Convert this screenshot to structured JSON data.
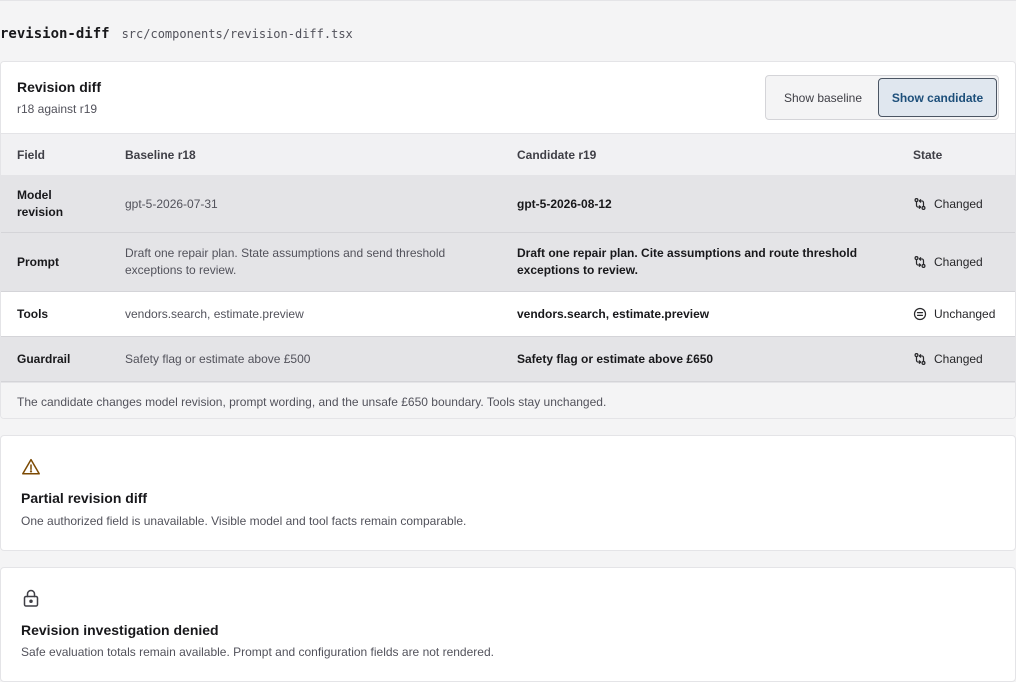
{
  "file": {
    "name": "revision-diff",
    "path": "src/components/revision-diff.tsx"
  },
  "card": {
    "title": "Revision diff",
    "subtitle": "r18 against r19",
    "toggle": {
      "baseline_label": "Show baseline",
      "candidate_label": "Show candidate",
      "selected": "candidate"
    }
  },
  "table": {
    "headers": {
      "field": "Field",
      "baseline": "Baseline r18",
      "candidate": "Candidate r19",
      "state": "State"
    },
    "rows": [
      {
        "field": "Model revision",
        "baseline": "gpt-5-2026-07-31",
        "candidate": "gpt-5-2026-08-12",
        "state": "Changed",
        "state_icon": "compare-arrows-icon"
      },
      {
        "field": "Prompt",
        "baseline": "Draft one repair plan. State assumptions and send threshold exceptions to review.",
        "candidate": "Draft one repair plan. Cite assumptions and route threshold exceptions to review.",
        "state": "Changed",
        "state_icon": "compare-arrows-icon"
      },
      {
        "field": "Tools",
        "baseline": "vendors.search, estimate.preview",
        "candidate": "vendors.search, estimate.preview",
        "state": "Unchanged",
        "state_icon": "equal-circle-icon"
      },
      {
        "field": "Guardrail",
        "baseline": "Safety flag or estimate above £500",
        "candidate": "Safety flag or estimate above £650",
        "state": "Changed",
        "state_icon": "compare-arrows-icon"
      }
    ],
    "summary": "The candidate changes model revision, prompt wording, and the unsafe £650 boundary. Tools stay unchanged."
  },
  "notices": {
    "partial": {
      "icon": "warning-triangle-icon",
      "title": "Partial revision diff",
      "body": "One authorized field is unavailable. Visible model and tool facts remain comparable."
    },
    "denied": {
      "icon": "lock-icon",
      "title": "Revision investigation denied",
      "body": "Safe evaluation totals remain available. Prompt and configuration fields are not rendered."
    }
  },
  "colors": {
    "accent": "#1d4f7a",
    "changed_row": "#e4e4e7",
    "warning_icon": "#7c4a03"
  }
}
